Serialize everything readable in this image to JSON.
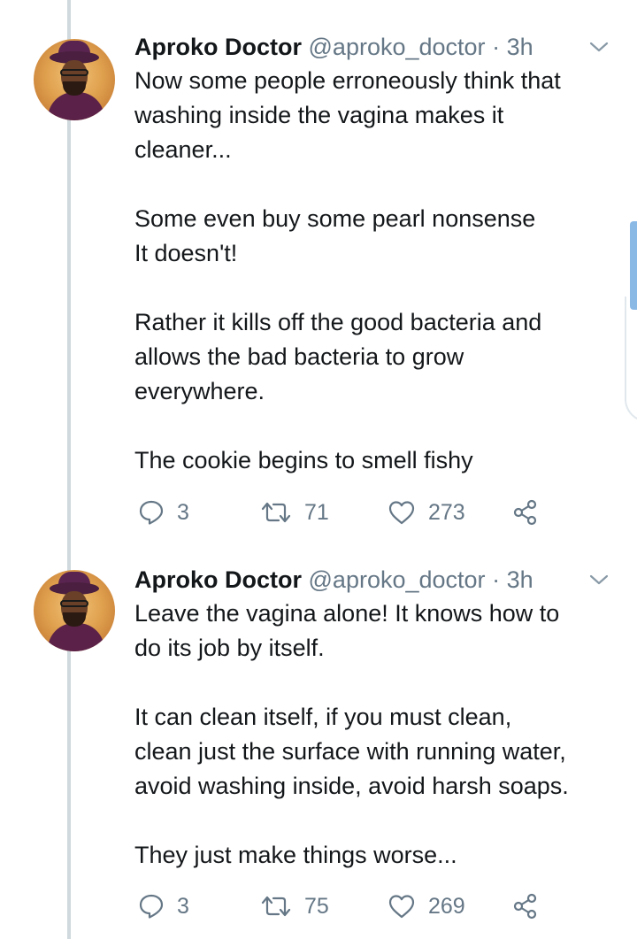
{
  "tweets": [
    {
      "author": {
        "name": "Aproko Doctor",
        "handle": "@aproko_doctor",
        "separator": "·",
        "time": "3h"
      },
      "lines": [
        "Now some people erroneously think that",
        "washing inside the vagina makes it",
        "cleaner...",
        "",
        "Some even buy some pearl nonsense",
        "It doesn't!",
        "",
        "Rather it kills off the good bacteria and",
        "allows the bad bacteria to grow",
        "everywhere.",
        "",
        "The cookie begins to smell fishy"
      ],
      "actions": {
        "replies": "3",
        "retweets": "71",
        "likes": "273"
      }
    },
    {
      "author": {
        "name": "Aproko Doctor",
        "handle": "@aproko_doctor",
        "separator": "·",
        "time": "3h"
      },
      "lines": [
        "Leave the vagina alone! It knows how to",
        "do its job by itself.",
        "",
        "It can clean itself, if you must clean,",
        "clean just the surface with running water,",
        "avoid washing inside, avoid harsh soaps.",
        "",
        "They just make things worse..."
      ],
      "actions": {
        "replies": "3",
        "retweets": "75",
        "likes": "269"
      }
    }
  ],
  "icons": {
    "reply": "reply-icon",
    "retweet": "retweet-icon",
    "like": "heart-icon",
    "share": "share-icon",
    "menu": "chevron-down-icon"
  },
  "colors": {
    "text": "#14171a",
    "secondary": "#657786",
    "thread_line": "#cfd9de",
    "scroll_accent": "#8ab9e6"
  }
}
